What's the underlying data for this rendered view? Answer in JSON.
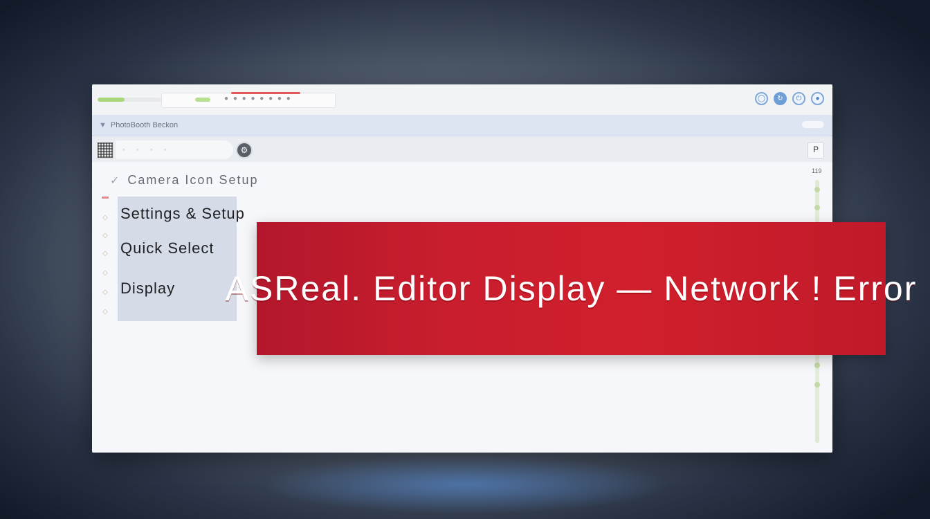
{
  "window": {
    "progress_fraction": 0.42,
    "breadcrumb": "PhotoBooth Beckon",
    "toolbar_side_label": "P",
    "rail_number": "119"
  },
  "urlbar": {
    "tools": "● ● ● ● ● ● ● ●"
  },
  "heading": {
    "check_icon": "✓",
    "text": "Camera Icon Setup"
  },
  "panel": {
    "lines": [
      "Settings & Setup",
      "Quick Select",
      "Display"
    ]
  },
  "banner": {
    "text": "ASReal. Editor Display — Network ! Error",
    "color": "#c81e2e"
  },
  "colors": {
    "accent": "#6f9fd7",
    "menubar": "#dde4f2",
    "progress": "#a9d77a"
  }
}
